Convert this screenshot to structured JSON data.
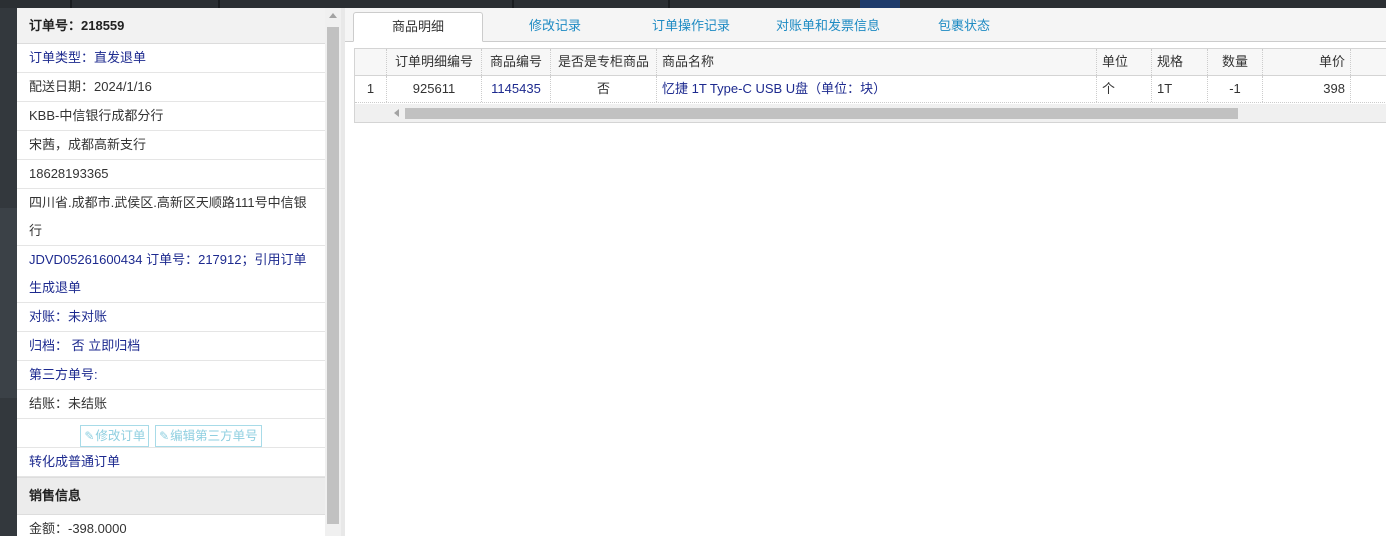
{
  "order_panel": {
    "order_no": "订单号：218559",
    "order_type": "订单类型：直发退单",
    "delivery_date": "配送日期：2024/1/16",
    "customer": "KBB-中信银行成都分行",
    "contact": "宋茜，成都高新支行",
    "phone": "18628193365",
    "address": "四川省.成都市.武侯区.高新区天顺路111号中信银行",
    "reference": "JDVD05261600434 订单号：217912；引用订单生成退单",
    "reconcile": "对账：未对账",
    "archive": "归档： 否 立即归档",
    "third_party_no": "第三方单号:",
    "settlement": "结账：未结账",
    "edit_order_btn": "修改订单",
    "edit_third_party_btn": "编辑第三方单号",
    "convert_link": "转化成普通订单",
    "sales_section": "销售信息",
    "amount": "金额：-398.0000"
  },
  "tabs": [
    {
      "label": "商品明细",
      "active": true
    },
    {
      "label": "修改记录",
      "active": false
    },
    {
      "label": "订单操作记录",
      "active": false
    },
    {
      "label": "对账单和发票信息",
      "active": false
    },
    {
      "label": "包裹状态",
      "active": false
    }
  ],
  "grid": {
    "columns": [
      "",
      "订单明细编号",
      "商品编号",
      "是否是专柜商品",
      "商品名称",
      "单位",
      "规格",
      "数量",
      "单价"
    ],
    "rows": [
      {
        "idx": "1",
        "detail_no": "925611",
        "product_no": "1145435",
        "is_counter": "否",
        "name": "忆捷 1T Type-C USB U盘（单位：块）",
        "unit": "个",
        "spec": "1T",
        "qty": "-1",
        "price": "398"
      }
    ]
  }
}
